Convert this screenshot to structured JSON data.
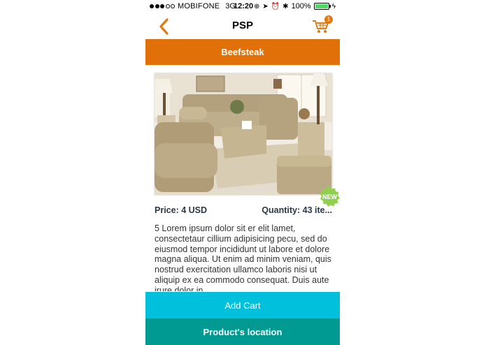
{
  "status_bar": {
    "carrier": "MOBIFONE",
    "network": "3G",
    "time": "12:20",
    "battery": "100%"
  },
  "nav": {
    "title": "PSP",
    "cart_count": "1",
    "accent_color": "#e07a12"
  },
  "category": {
    "title": "Beefsteak",
    "color": "#e27008"
  },
  "product": {
    "badge": "NEW",
    "price": "Price: 4 USD",
    "quantity": "Quantity: 43 ite...",
    "description": "5 Lorem ipsum dolor sit er elit lamet, consectetaur cillium adipisicing pecu, sed do eiusmod tempor incididunt ut labore et dolore magna aliqua. Ut enim ad minim veniam, quis nostrud exercitation ullamco laboris nisi ut aliquip ex ea commodo consequat. Duis aute irure dolor in"
  },
  "actions": {
    "add_cart": "Add Cart",
    "location": "Product's location"
  },
  "colors": {
    "add_cart": "#00c0db",
    "location": "#009a92",
    "badge": "#8fd14f"
  },
  "icons": [
    "back-chevron-icon",
    "cart-icon",
    "bluetooth-icon",
    "alarm-icon",
    "battery-icon"
  ]
}
